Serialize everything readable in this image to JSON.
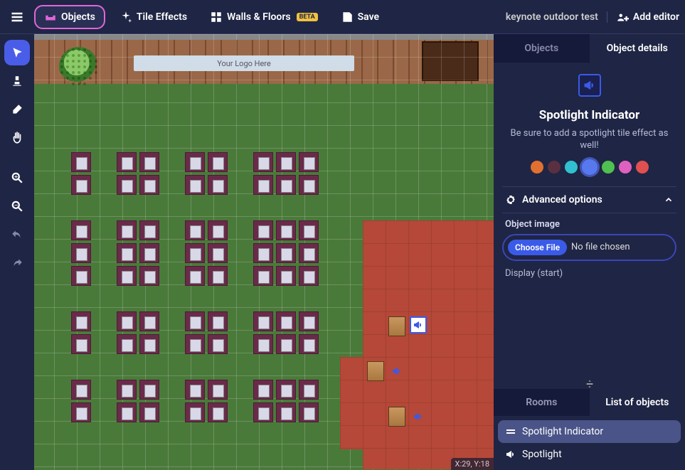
{
  "topbar": {
    "nav": {
      "objects": "Objects",
      "tile_effects": "Tile Effects",
      "walls_floors": "Walls & Floors",
      "beta_badge": "BETA",
      "save": "Save"
    },
    "project_name": "keynote outdoor test",
    "add_editor": "Add editor"
  },
  "canvas": {
    "logo_placeholder": "Your Logo Here",
    "coords": "X:29, Y:18"
  },
  "right_panel": {
    "tabs": {
      "objects": "Objects",
      "details": "Object details"
    },
    "object": {
      "title": "Spotlight Indicator",
      "description": "Be sure to add a spotlight tile effect as well!",
      "colors": [
        "#e07030",
        "#5a3040",
        "#30c0d0",
        "#5878f0",
        "#50c050",
        "#e060c0",
        "#e05050"
      ],
      "selected_color_index": 3
    },
    "advanced_label": "Advanced options",
    "image_section_label": "Object image",
    "file_button": "Choose File",
    "file_status": "No file chosen",
    "display_label": "Display (start)"
  },
  "bottom_panel": {
    "tabs": {
      "rooms": "Rooms",
      "list": "List of objects"
    },
    "items": [
      {
        "label": "Spotlight Indicator",
        "icon": "drag",
        "selected": true
      },
      {
        "label": "Spotlight",
        "icon": "bullhorn",
        "selected": false
      }
    ]
  }
}
